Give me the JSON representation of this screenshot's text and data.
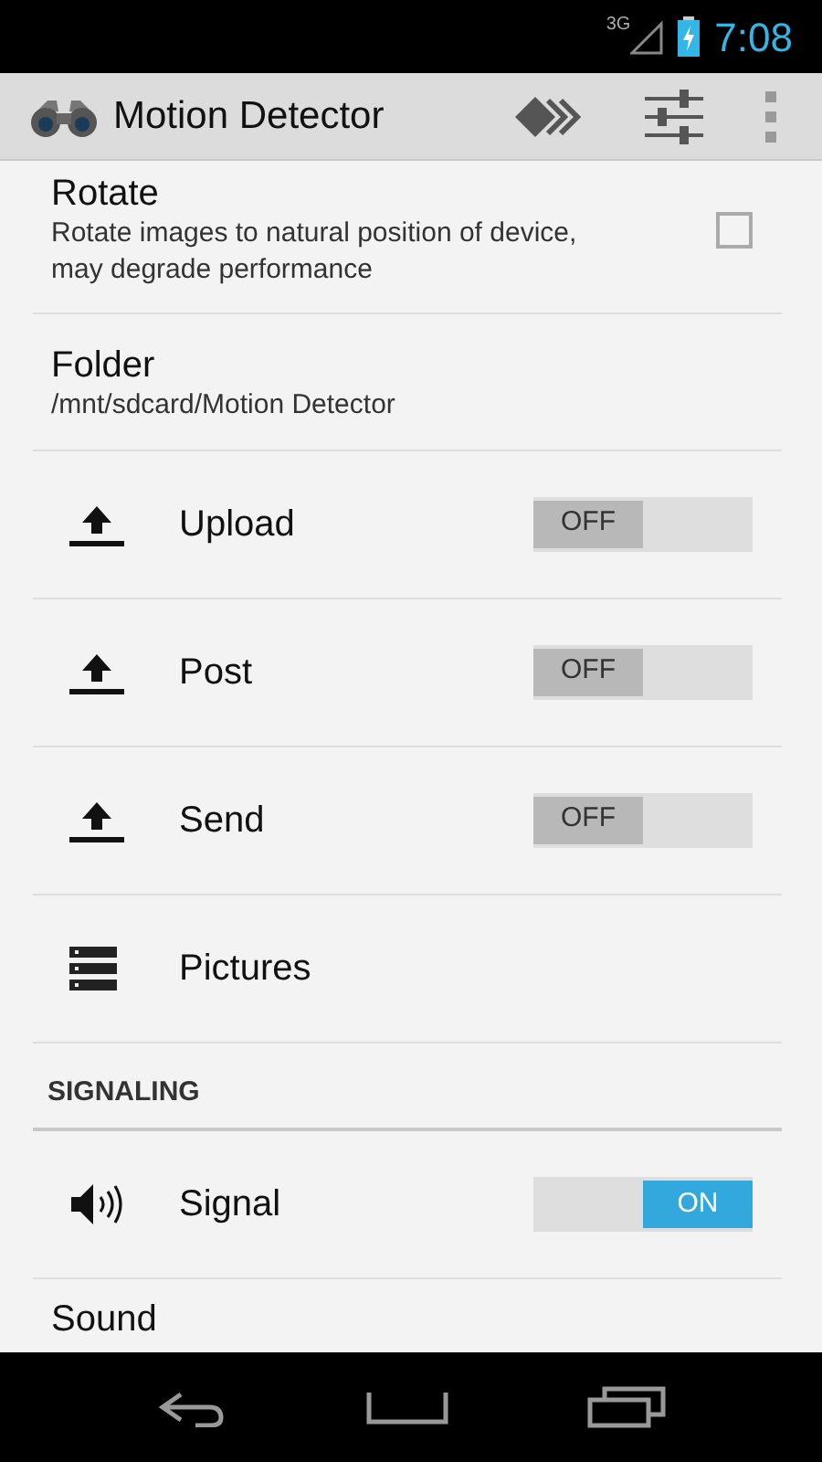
{
  "status_bar": {
    "network": "3G",
    "time": "7:08"
  },
  "app_bar": {
    "title": "Motion Detector"
  },
  "items": [
    {
      "kind": "checkbox",
      "title": "Rotate",
      "summary": "Rotate images to natural position of device, may degrade performance",
      "checked": false
    },
    {
      "kind": "text",
      "title": "Folder",
      "summary": "/mnt/sdcard/Motion Detector"
    },
    {
      "kind": "toggle",
      "title": "Upload",
      "on": false,
      "switch_text": "OFF"
    },
    {
      "kind": "toggle",
      "title": "Post",
      "on": false,
      "switch_text": "OFF"
    },
    {
      "kind": "toggle",
      "title": "Send",
      "on": false,
      "switch_text": "OFF"
    },
    {
      "kind": "link",
      "title": "Pictures"
    },
    {
      "kind": "header",
      "title": "SIGNALING"
    },
    {
      "kind": "toggle",
      "title": "Signal",
      "on": true,
      "switch_text": "ON"
    },
    {
      "kind": "text",
      "title": "Sound"
    }
  ]
}
